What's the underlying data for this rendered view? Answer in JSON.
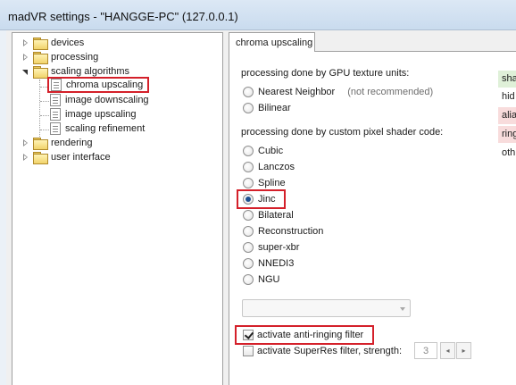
{
  "window": {
    "title": "madVR settings - \"HANGGE-PC\" (127.0.0.1)"
  },
  "tree": {
    "items": [
      {
        "label": "devices",
        "type": "folder",
        "expander": "closed"
      },
      {
        "label": "processing",
        "type": "folder",
        "expander": "closed"
      },
      {
        "label": "scaling algorithms",
        "type": "folder",
        "expander": "open"
      },
      {
        "label": "chroma upscaling",
        "type": "page",
        "selected": true
      },
      {
        "label": "image downscaling",
        "type": "page"
      },
      {
        "label": "image upscaling",
        "type": "page"
      },
      {
        "label": "scaling refinement",
        "type": "page"
      },
      {
        "label": "rendering",
        "type": "folder",
        "expander": "closed"
      },
      {
        "label": "user interface",
        "type": "folder",
        "expander": "closed"
      }
    ]
  },
  "tab": {
    "label": "chroma upscaling"
  },
  "gpu_section": {
    "heading": "processing done by GPU texture units:",
    "options": [
      {
        "label": "Nearest Neighbor",
        "note": "(not recommended)",
        "checked": false
      },
      {
        "label": "Bilinear",
        "checked": false
      }
    ]
  },
  "shader_section": {
    "heading": "processing done by custom pixel shader code:",
    "options": [
      {
        "label": "Cubic",
        "checked": false
      },
      {
        "label": "Lanczos",
        "checked": false
      },
      {
        "label": "Spline",
        "checked": false
      },
      {
        "label": "Jinc",
        "checked": true
      },
      {
        "label": "Bilateral",
        "checked": false
      },
      {
        "label": "Reconstruction",
        "checked": false
      },
      {
        "label": "super-xbr",
        "checked": false
      },
      {
        "label": "NNEDI3",
        "checked": false
      },
      {
        "label": "NGU",
        "checked": false
      }
    ]
  },
  "taps_combo": {
    "value": "",
    "disabled": true
  },
  "anti_ringing": {
    "label": "activate anti-ringing filter",
    "checked": true
  },
  "superres": {
    "label": "activate SuperRes filter, strength:",
    "checked": false,
    "strength": "3",
    "decrement": "◂",
    "increment": "▸"
  },
  "side_labels": [
    {
      "text": "sha",
      "color": "#dff0d8"
    },
    {
      "text": "hid",
      "color": "#ffffff"
    },
    {
      "text": "alia",
      "color": "#f8dcdc"
    },
    {
      "text": "ring",
      "color": "#f8dcdc"
    },
    {
      "text": "oth",
      "color": "#ffffff"
    }
  ],
  "colors": {
    "highlight_border": "#d4202a"
  }
}
